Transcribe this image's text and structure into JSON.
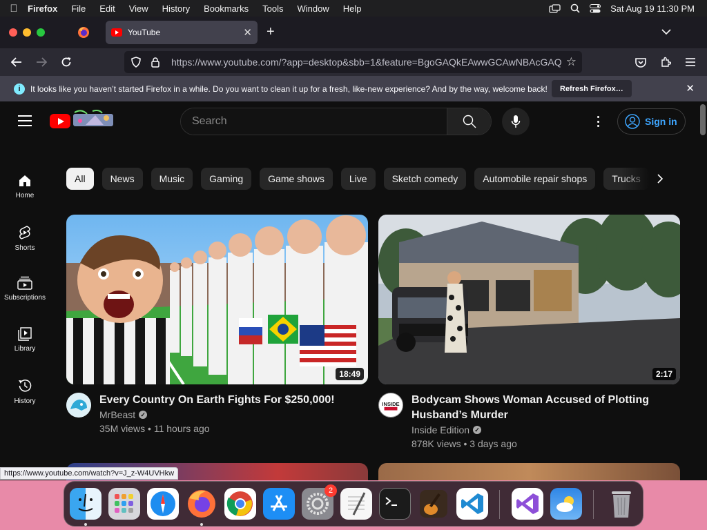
{
  "menubar": {
    "app_name": "Firefox",
    "menus": [
      "File",
      "Edit",
      "View",
      "History",
      "Bookmarks",
      "Tools",
      "Window",
      "Help"
    ],
    "clock": "Sat Aug 19  11:30 PM"
  },
  "browser": {
    "active_tab_title": "YouTube",
    "url_host": "https://www.youtube.com",
    "url_rest": "/?app=desktop&sbb=1&feature=BgoGAQkEAwwGCAwNBAcGAQ",
    "notification": {
      "text": "It looks like you haven’t started Firefox in a while. Do you want to clean it up for a fresh, like-new experience? And by the way, welcome back!",
      "button": "Refresh Firefox…"
    },
    "status_url": "https://www.youtube.com/watch?v=J_z-W4UVHkw"
  },
  "youtube": {
    "search_placeholder": "Search",
    "sign_in": "Sign in",
    "chips": [
      "All",
      "News",
      "Music",
      "Gaming",
      "Game shows",
      "Live",
      "Sketch comedy",
      "Automobile repair shops",
      "Trucks"
    ],
    "sidebar": [
      {
        "label": "Home",
        "icon": "home-icon"
      },
      {
        "label": "Shorts",
        "icon": "shorts-icon"
      },
      {
        "label": "Subscriptions",
        "icon": "subscriptions-icon"
      },
      {
        "label": "Library",
        "icon": "library-icon"
      },
      {
        "label": "History",
        "icon": "history-icon"
      }
    ],
    "videos": [
      {
        "title": "Every Country On Earth Fights For $250,000!",
        "channel": "MrBeast",
        "views": "35M views",
        "age": "11 hours ago",
        "duration": "18:49"
      },
      {
        "title": "Bodycam Shows Woman Accused of Plotting Husband’s Murder",
        "channel": "Inside Edition",
        "channel_avatar_text": "INSIDE",
        "views": "878K views",
        "age": "3 days ago",
        "duration": "2:17"
      }
    ]
  },
  "dock": {
    "apps": [
      "Finder",
      "Launchpad",
      "Safari",
      "Firefox",
      "Chrome",
      "App Store",
      "System Settings",
      "TextEdit",
      "Terminal",
      "GarageBand",
      "Visual Studio Code",
      "Visual Studio",
      "Weather",
      "Trash"
    ],
    "settings_badge": "2"
  },
  "colors": {
    "youtube_red": "#ff0000",
    "link_blue": "#3ea6ff",
    "bg_dark": "#0f0f0f"
  }
}
